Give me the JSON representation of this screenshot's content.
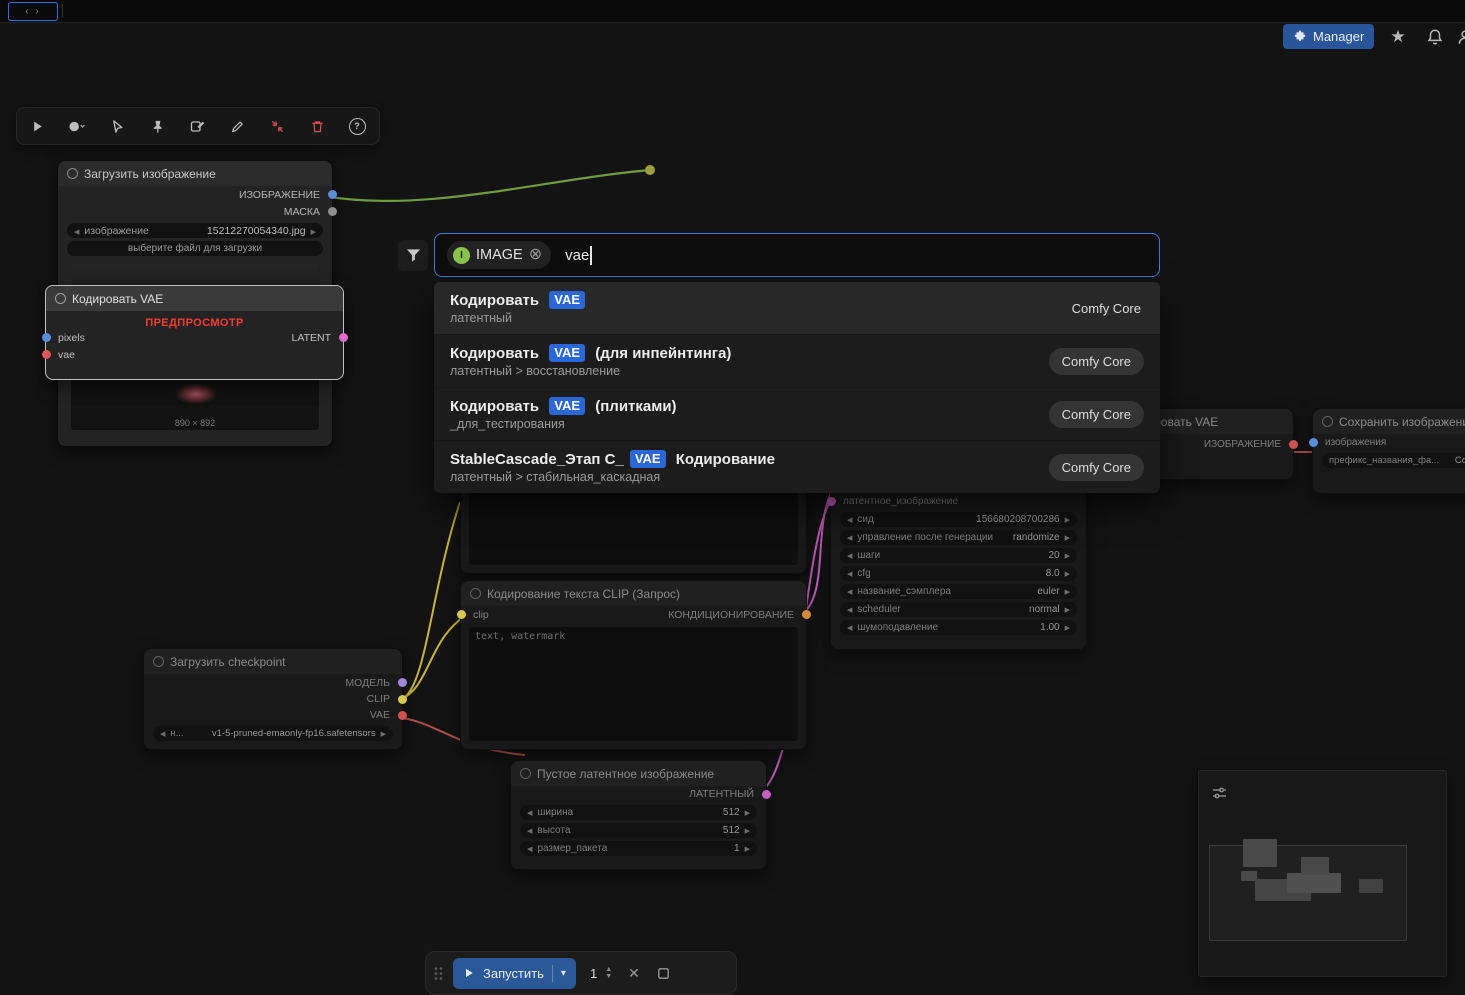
{
  "topbar": {
    "manager": "Manager"
  },
  "search": {
    "filter_chip_letter": "I",
    "filter_chip": "IMAGE",
    "query": "vae",
    "results": [
      {
        "pre": "Кодировать ",
        "chip": "VAE",
        "post": "",
        "sub": "латентный",
        "badge": "Comfy Core"
      },
      {
        "pre": "Кодировать ",
        "chip": "VAE",
        "post": " (для инпейнтинга)",
        "sub": "латентный > восстановление",
        "badge": "Comfy Core"
      },
      {
        "pre": "Кодировать ",
        "chip": "VAE",
        "post": " (плитками)",
        "sub": "_для_тестирования",
        "badge": "Comfy Core"
      },
      {
        "pre": "StableCascade_Этап C_",
        "chip": "VAE",
        "post": " Кодирование",
        "sub": "латентный > стабильная_каскадная",
        "badge": "Comfy Core"
      }
    ]
  },
  "nodes": {
    "load_image": {
      "title": "Загрузить изображение",
      "out1": "ИЗОБРАЖЕНИЕ",
      "out2": "МАСКА",
      "widget_label": "изображение",
      "widget_value": "15212270054340.jpg",
      "upload": "выберите файл для загрузки",
      "size": "890 × 892"
    },
    "vae_encode": {
      "title": "Кодировать VAE",
      "preview": "ПРЕДПРОСМОТР",
      "in1": "pixels",
      "in2": "vae",
      "out": "LATENT"
    },
    "checkpoint": {
      "title": "Загрузить checkpoint",
      "out1": "МОДЕЛЬ",
      "out2": "CLIP",
      "out3": "VAE",
      "widget_label": "н...",
      "widget_value": "v1-5-pruned-emaonly-fp16.safetensors"
    },
    "clip_encode": {
      "title": "Кодирование текста CLIP (Запрос)",
      "in": "clip",
      "out": "КОНДИЦИОНИРОВАНИЕ",
      "text": "text, watermark"
    },
    "ksampler": {
      "in": "латентное_изображение",
      "widgets": [
        {
          "label": "сид",
          "value": "156680208700286"
        },
        {
          "label": "управление после генерации",
          "value": "randomize"
        },
        {
          "label": "шаги",
          "value": "20"
        },
        {
          "label": "cfg",
          "value": "8.0"
        },
        {
          "label": "название_сэмплера",
          "value": "euler"
        },
        {
          "label": "scheduler",
          "value": "normal"
        },
        {
          "label": "шумоподавление",
          "value": "1.00"
        }
      ]
    },
    "empty_latent": {
      "title": "Пустое латентное изображение",
      "out": "ЛАТЕНТНЫЙ",
      "widgets": [
        {
          "label": "ширина",
          "value": "512"
        },
        {
          "label": "высота",
          "value": "512"
        },
        {
          "label": "размер_пакета",
          "value": "1"
        }
      ]
    },
    "vae_encode2": {
      "title": "Кодировать VAE",
      "out": "ИЗОБРАЖЕНИЕ"
    },
    "save_image": {
      "title": "Сохранить изображение",
      "in": "изображения",
      "widget_label": "префикс_названия_фа...",
      "widget_value": "Co"
    }
  },
  "run_bar": {
    "run": "Запустить",
    "count": "1"
  }
}
